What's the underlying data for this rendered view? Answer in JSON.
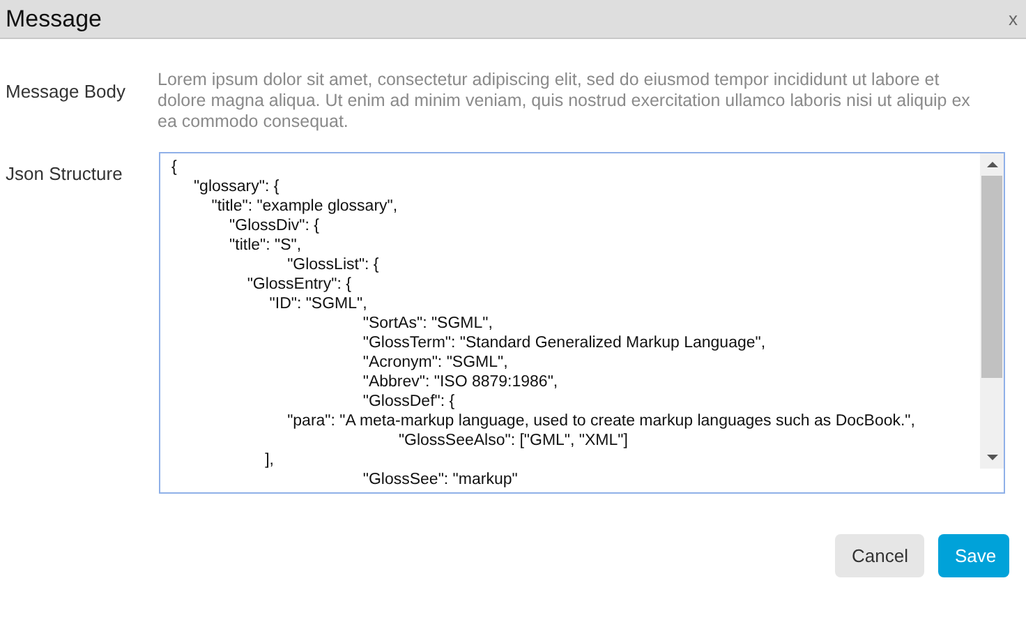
{
  "window": {
    "title": "Message",
    "close": "x"
  },
  "fields": [
    {
      "kind": "text",
      "label": "Message Body",
      "value": "Lorem ipsum dolor sit amet, consectetur adipiscing elit, sed do eiusmod tempor incididunt ut labore et dolore magna aliqua. Ut enim ad minim veniam, quis nostrud exercitation ullamco laboris nisi ut aliquip ex ea commodo consequat."
    },
    {
      "kind": "code",
      "label": "Json Structure",
      "lines": [
        "{",
        "     \"glossary\": {",
        "         \"title\": \"example glossary\",",
        "             \"GlossDiv\": {",
        "             \"title\": \"S\",",
        "                          \"GlossList\": {",
        "                 \"GlossEntry\": {",
        "                      \"ID\": \"SGML\",",
        "                                           \"SortAs\": \"SGML\",",
        "                                           \"GlossTerm\": \"Standard Generalized Markup Language\",",
        "                                           \"Acronym\": \"SGML\",",
        "                                           \"Abbrev\": \"ISO 8879:1986\",",
        "                                           \"GlossDef\": {",
        "                          \"para\": \"A meta-markup language, used to create markup languages such as DocBook.\",",
        "                                                   \"GlossSeeAlso\": [\"GML\", \"XML\"]",
        "                     ],",
        "                                           \"GlossSee\": \"markup\""
      ]
    }
  ],
  "buttons": [
    {
      "kind": "secondary",
      "label": "Cancel"
    },
    {
      "kind": "primary",
      "label": "Save"
    }
  ]
}
